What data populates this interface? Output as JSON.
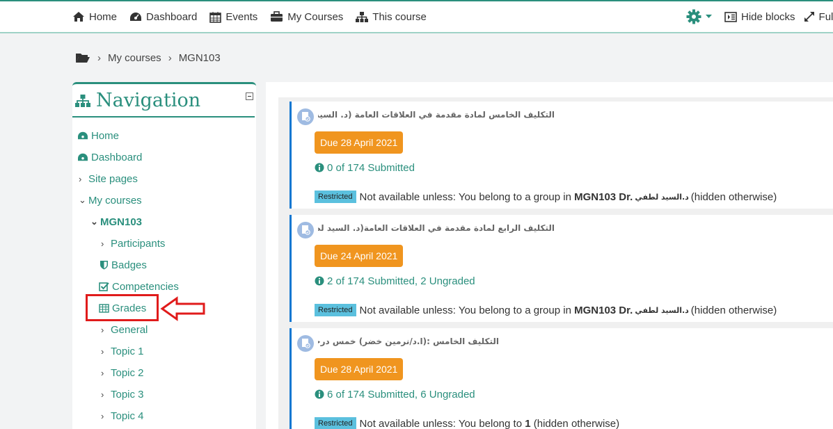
{
  "topnav": {
    "items": [
      {
        "label": "Home",
        "icon": "home-icon"
      },
      {
        "label": "Dashboard",
        "icon": "dashboard-icon"
      },
      {
        "label": "Events",
        "icon": "calendar-icon"
      },
      {
        "label": "My Courses",
        "icon": "briefcase-icon"
      },
      {
        "label": "This course",
        "icon": "sitemap-icon"
      }
    ],
    "hide_blocks": "Hide blocks",
    "full": "Full"
  },
  "breadcrumb": {
    "items": [
      "My courses",
      "MGN103"
    ]
  },
  "navigation": {
    "title": "Navigation",
    "items": [
      {
        "label": "Home",
        "icon": "dashboard-icon"
      },
      {
        "label": "Dashboard",
        "icon": "dashboard-icon"
      },
      {
        "label": "Site pages",
        "chevron": "›"
      },
      {
        "label": "My courses",
        "chevron": "⌄"
      },
      {
        "label": "MGN103",
        "chevron": "⌄"
      },
      {
        "label": "Participants",
        "chevron": "›"
      },
      {
        "label": "Badges",
        "icon": "shield-icon"
      },
      {
        "label": "Competencies",
        "icon": "check-square-icon"
      },
      {
        "label": "Grades",
        "icon": "table-icon"
      },
      {
        "label": "General",
        "chevron": "›"
      },
      {
        "label": "Topic 1",
        "chevron": "›"
      },
      {
        "label": "Topic 2",
        "chevron": "›"
      },
      {
        "label": "Topic 3",
        "chevron": "›"
      },
      {
        "label": "Topic 4",
        "chevron": "›"
      }
    ]
  },
  "activities": [
    {
      "title": "التكليف الخامس لمادة مقدمة في العلاقات العامة (د. السيد لطفي)",
      "due": "Due 28 April 2021",
      "submitted": "0 of 174 Submitted",
      "restricted_label": "Restricted",
      "restriction_prefix": "Not available unless: You belong to a group in",
      "restriction_bold": "MGN103 Dr.",
      "restriction_arabic": "د.السيد لطفي",
      "restriction_suffix": "(hidden otherwise)"
    },
    {
      "title": "التكليف الرابع لمادة مقدمة في العلاقات العامة(د. السيد لطفي)",
      "due": "Due 24 April 2021",
      "submitted": "2 of 174 Submitted, 2 Ungraded",
      "restricted_label": "Restricted",
      "restriction_prefix": "Not available unless: You belong to a group in",
      "restriction_bold": "MGN103 Dr.",
      "restriction_arabic": "د.السيد لطفي",
      "restriction_suffix": "(hidden otherwise)"
    },
    {
      "title": "التكليف الخامس :(ا.د/نرمين خضر) خمس درجات",
      "due": "Due 28 April 2021",
      "submitted": "6 of 174 Submitted, 6 Ungraded",
      "restricted_label": "Restricted",
      "restriction_prefix": "Not available unless: You belong to",
      "restriction_bold": "1",
      "restriction_suffix": "(hidden otherwise)"
    }
  ],
  "colors": {
    "brand": "#2a8f7d",
    "due_badge": "#f0951f",
    "restricted_badge": "#5bc0de",
    "highlight": "#e01b1b"
  }
}
